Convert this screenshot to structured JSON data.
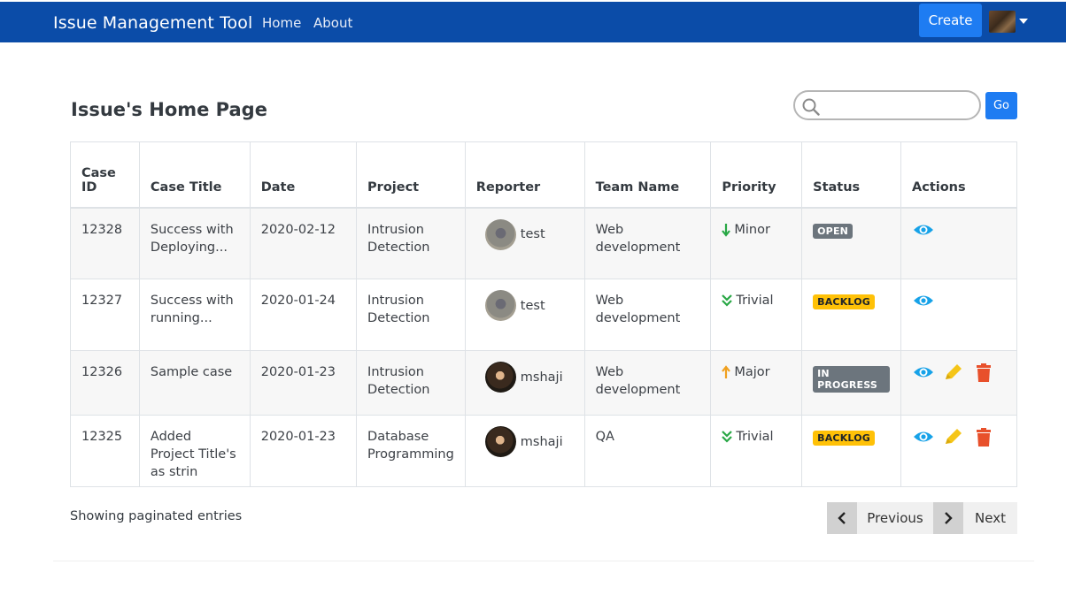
{
  "navbar": {
    "brand": "Issue Management Tool",
    "links": [
      "Home",
      "About"
    ],
    "create_label": "Create"
  },
  "page": {
    "title": "Issue's Home Page"
  },
  "search": {
    "placeholder": "",
    "go_label": "Go"
  },
  "table": {
    "headers": [
      "Case ID",
      "Case Title",
      "Date",
      "Project",
      "Reporter",
      "Team Name",
      "Priority",
      "Status",
      "Actions"
    ],
    "rows": [
      {
        "id": "12328",
        "title": "Success with Deploying...",
        "date": "2020-02-12",
        "project": "Intrusion Detection",
        "reporter": "test",
        "team": "Web development",
        "priority": "Minor",
        "priority_icon": "arrow-down-icon",
        "status": "OPEN",
        "actions": [
          "view"
        ]
      },
      {
        "id": "12327",
        "title": "Success with running...",
        "date": "2020-01-24",
        "project": "Intrusion Detection",
        "reporter": "test",
        "team": "Web development",
        "priority": "Trivial",
        "priority_icon": "double-chevron-down-icon",
        "status": "BACKLOG",
        "actions": [
          "view"
        ]
      },
      {
        "id": "12326",
        "title": "Sample case",
        "date": "2020-01-23",
        "project": "Intrusion Detection",
        "reporter": "mshaji",
        "team": "Web development",
        "priority": "Major",
        "priority_icon": "arrow-up-icon",
        "status": "IN PROGRESS",
        "actions": [
          "view",
          "edit",
          "delete"
        ]
      },
      {
        "id": "12325",
        "title": "Added Project Title's as strin",
        "date": "2020-01-23",
        "project": "Database Programming",
        "reporter": "mshaji",
        "team": "QA",
        "priority": "Trivial",
        "priority_icon": "double-chevron-down-icon",
        "status": "BACKLOG",
        "actions": [
          "view",
          "edit",
          "delete"
        ]
      }
    ]
  },
  "footer": {
    "showing": "Showing paginated entries",
    "previous": "Previous",
    "next": "Next"
  },
  "colors": {
    "navbar": "#0b4ca8",
    "primary_button": "#1e7cf2",
    "view_icon": "#17a2e8",
    "edit_icon": "#f5c518",
    "delete_icon": "#e8502b",
    "priority_down": "#28a745",
    "priority_up": "#f0a01e",
    "badge_backlog": "#ffc107",
    "badge_gray": "#6c757d"
  }
}
